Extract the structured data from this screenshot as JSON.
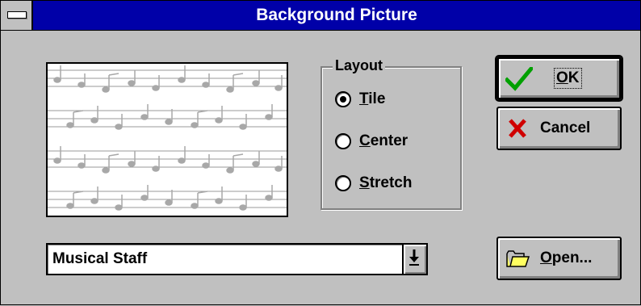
{
  "window": {
    "title": "Background Picture"
  },
  "layout_group": {
    "label": "Layout",
    "options": [
      {
        "mnemonic": "T",
        "rest": "ile",
        "checked": true
      },
      {
        "mnemonic": "C",
        "rest": "enter",
        "checked": false
      },
      {
        "mnemonic": "S",
        "rest": "tretch",
        "checked": false
      }
    ]
  },
  "buttons": {
    "ok": {
      "mnemonic": "O",
      "rest": "K"
    },
    "cancel": {
      "label": "Cancel"
    },
    "open": {
      "mnemonic": "O",
      "rest": "pen..."
    }
  },
  "picture_select": {
    "value": "Musical Staff"
  },
  "icons": {
    "ok": "checkmark-icon",
    "cancel": "x-icon",
    "open": "folder-open-icon",
    "dropdown": "dropdown-arrow-icon",
    "system_menu": "system-menu-icon"
  },
  "colors": {
    "titlebar": "#0000a8",
    "dialog_face": "#c0c0c0",
    "check_green": "#00a000",
    "cancel_red": "#d00000"
  }
}
